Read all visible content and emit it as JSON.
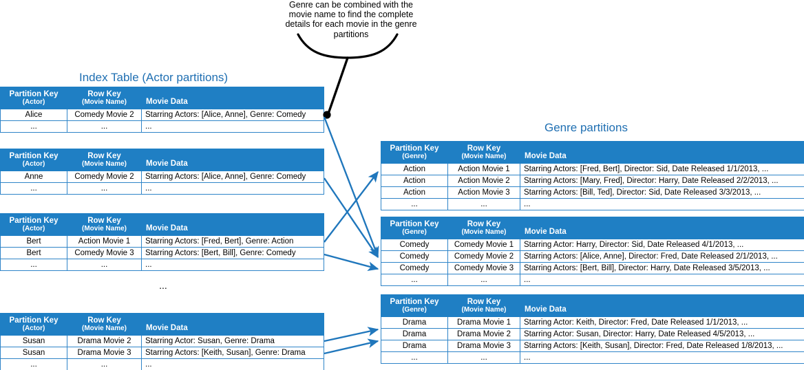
{
  "callout": {
    "text": "Genre can be combined with the movie name to find the complete details for each movie in the genre partitions"
  },
  "titles": {
    "index_table": "Index Table (Actor partitions)",
    "genre_partitions": "Genre partitions"
  },
  "colors": {
    "header_blue": "#1F7FC4",
    "title_blue": "#1F6FB2",
    "border_blue": "#2E84C8",
    "arrow_blue": "#2077BC",
    "callout_black": "#000000"
  },
  "headers": {
    "actor": {
      "partition_key": "Partition Key",
      "partition_key_sub": "(Actor)",
      "row_key": "Row Key",
      "row_key_sub": "(Movie Name)",
      "movie_data": "Movie Data"
    },
    "genre": {
      "partition_key": "Partition Key",
      "partition_key_sub": "(Genre)",
      "row_key": "Row Key",
      "row_key_sub": "(Movie Name)",
      "movie_data": "Movie Data"
    }
  },
  "ellipsis": "...",
  "mid_ellipsis": "...",
  "actor_tables": [
    {
      "id": "alice",
      "rows": [
        {
          "partition_key": "Alice",
          "row_key": "Comedy Movie 2",
          "movie_data": "Starring Actors: [Alice, Anne], Genre: Comedy"
        },
        {
          "partition_key": "...",
          "row_key": "...",
          "movie_data": "..."
        }
      ]
    },
    {
      "id": "anne",
      "rows": [
        {
          "partition_key": "Anne",
          "row_key": "Comedy Movie 2",
          "movie_data": "Starring Actors: [Alice, Anne], Genre: Comedy"
        },
        {
          "partition_key": "...",
          "row_key": "...",
          "movie_data": "..."
        }
      ]
    },
    {
      "id": "bert",
      "rows": [
        {
          "partition_key": "Bert",
          "row_key": "Action Movie 1",
          "movie_data": "Starring Actors: [Fred, Bert], Genre: Action"
        },
        {
          "partition_key": "Bert",
          "row_key": "Comedy Movie 3",
          "movie_data": "Starring Actors: [Bert, Bill], Genre: Comedy"
        },
        {
          "partition_key": "...",
          "row_key": "...",
          "movie_data": "..."
        }
      ]
    },
    {
      "id": "susan",
      "rows": [
        {
          "partition_key": "Susan",
          "row_key": "Drama Movie 2",
          "movie_data": "Starring Actor: Susan, Genre: Drama"
        },
        {
          "partition_key": "Susan",
          "row_key": "Drama Movie 3",
          "movie_data": "Starring Actors: [Keith, Susan], Genre: Drama"
        },
        {
          "partition_key": "...",
          "row_key": "...",
          "movie_data": "..."
        }
      ]
    }
  ],
  "genre_tables": [
    {
      "id": "action",
      "rows": [
        {
          "partition_key": "Action",
          "row_key": "Action Movie 1",
          "movie_data": "Starring Actors: [Fred, Bert], Director: Sid, Date Released 1/1/2013, ..."
        },
        {
          "partition_key": "Action",
          "row_key": "Action Movie 2",
          "movie_data": "Starring Actors: [Mary, Fred], Director: Harry, Date Released 2/2/2013, ..."
        },
        {
          "partition_key": "Action",
          "row_key": "Action Movie 3",
          "movie_data": "Starring Actors: [Bill, Ted], Director: Sid, Date Released 3/3/2013, ..."
        },
        {
          "partition_key": "...",
          "row_key": "...",
          "movie_data": "..."
        }
      ]
    },
    {
      "id": "comedy",
      "rows": [
        {
          "partition_key": "Comedy",
          "row_key": "Comedy Movie 1",
          "movie_data": "Starring Actor: Harry, Director: Sid, Date Released 4/1/2013, ..."
        },
        {
          "partition_key": "Comedy",
          "row_key": "Comedy Movie 2",
          "movie_data": "Starring Actors: [Alice, Anne], Director: Fred, Date Released 2/1/2013, ..."
        },
        {
          "partition_key": "Comedy",
          "row_key": "Comedy Movie 3",
          "movie_data": "Starring Actors: [Bert, Bill], Director: Harry, Date Released 3/5/2013, ..."
        },
        {
          "partition_key": "...",
          "row_key": "...",
          "movie_data": "..."
        }
      ]
    },
    {
      "id": "drama",
      "rows": [
        {
          "partition_key": "Drama",
          "row_key": "Drama Movie 1",
          "movie_data": "Starring Actor: Keith, Director: Fred, Date Released 1/1/2013, ..."
        },
        {
          "partition_key": "Drama",
          "row_key": "Drama Movie 2",
          "movie_data": "Starring Actor: Susan, Director: Harry, Date Released 4/5/2013, ..."
        },
        {
          "partition_key": "Drama",
          "row_key": "Drama Movie 3",
          "movie_data": "Starring Actors: [Keith, Susan], Director: Fred, Date Released 1/8/2013, ..."
        },
        {
          "partition_key": "...",
          "row_key": "...",
          "movie_data": "..."
        }
      ]
    }
  ]
}
